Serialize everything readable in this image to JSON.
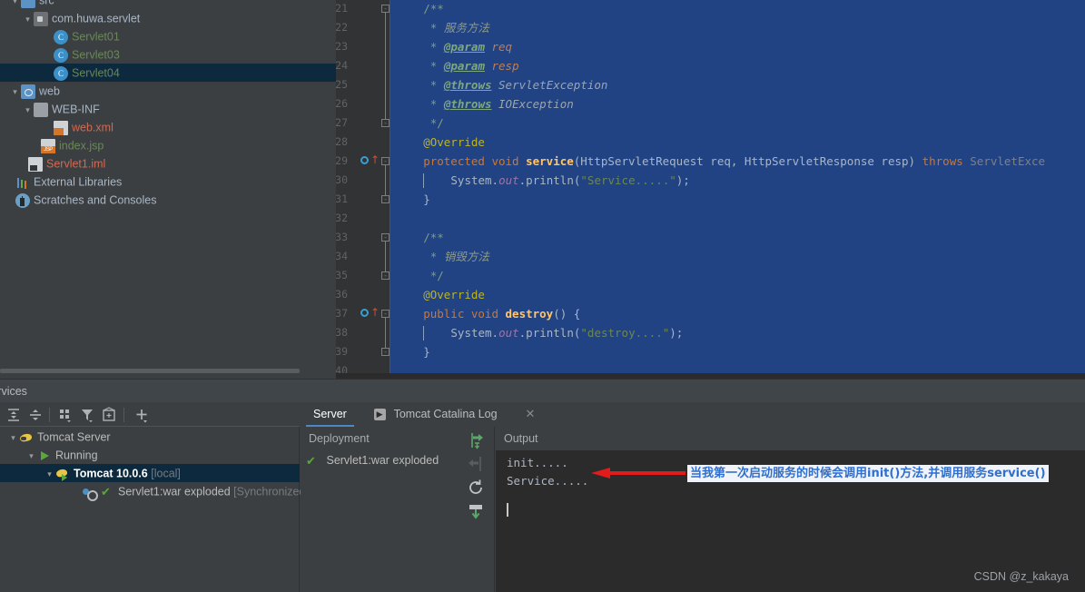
{
  "project_tree": {
    "items": [
      {
        "label": "src",
        "icon": "folder-blue-icon",
        "indent": 10,
        "arrow": "v",
        "color": "grey",
        "selected": false,
        "partial_top": true
      },
      {
        "label": "com.huwa.servlet",
        "icon": "package-icon",
        "indent": 24,
        "arrow": "v",
        "color": "grey",
        "selected": false
      },
      {
        "label": "Servlet01",
        "icon": "java-class-icon",
        "indent": 46,
        "arrow": "",
        "color": "green",
        "selected": false
      },
      {
        "label": "Servlet03",
        "icon": "java-class-icon",
        "indent": 46,
        "arrow": "",
        "color": "green",
        "selected": false
      },
      {
        "label": "Servlet04",
        "icon": "java-class-icon",
        "indent": 46,
        "arrow": "",
        "color": "green",
        "selected": true
      },
      {
        "label": "web",
        "icon": "web-folder-icon",
        "indent": 10,
        "arrow": "v",
        "color": "grey",
        "selected": false
      },
      {
        "label": "WEB-INF",
        "icon": "folder-icon",
        "indent": 24,
        "arrow": "v",
        "color": "grey",
        "selected": false
      },
      {
        "label": "web.xml",
        "icon": "xml-file-icon",
        "indent": 46,
        "arrow": "",
        "color": "red",
        "selected": false
      },
      {
        "label": "index.jsp",
        "icon": "jsp-file-icon",
        "indent": 32,
        "arrow": "",
        "color": "green",
        "selected": false
      },
      {
        "label": "Servlet1.iml",
        "icon": "iml-file-icon",
        "indent": 18,
        "arrow": "",
        "color": "red",
        "selected": false
      },
      {
        "label": "External Libraries",
        "icon": "library-icon",
        "indent": 4,
        "arrow": "",
        "color": "grey",
        "selected": false
      },
      {
        "label": "Scratches and Consoles",
        "icon": "scratches-icon",
        "indent": 4,
        "arrow": "",
        "color": "grey",
        "selected": false
      }
    ]
  },
  "editor": {
    "first_line": 21,
    "last_line": 40,
    "gutter_override_lines": [
      29,
      37
    ],
    "lines": [
      {
        "n": 21,
        "indent": 4,
        "tokens": [
          {
            "t": "/**",
            "c": "c-cmt"
          }
        ]
      },
      {
        "n": 22,
        "indent": 5,
        "tokens": [
          {
            "t": "* ",
            "c": "c-cmt"
          },
          {
            "t": "服务方法",
            "c": "c-cmt-txt"
          }
        ]
      },
      {
        "n": 23,
        "indent": 5,
        "tokens": [
          {
            "t": "* ",
            "c": "c-cmt"
          },
          {
            "t": "@param",
            "c": "c-tag"
          },
          {
            "t": " req",
            "c": "c-param"
          }
        ]
      },
      {
        "n": 24,
        "indent": 5,
        "tokens": [
          {
            "t": "* ",
            "c": "c-cmt"
          },
          {
            "t": "@param",
            "c": "c-tag"
          },
          {
            "t": " resp",
            "c": "c-param"
          }
        ]
      },
      {
        "n": 25,
        "indent": 5,
        "tokens": [
          {
            "t": "* ",
            "c": "c-cmt"
          },
          {
            "t": "@throws",
            "c": "c-tag"
          },
          {
            "t": " ServletException",
            "c": "c-type-it"
          }
        ]
      },
      {
        "n": 26,
        "indent": 5,
        "tokens": [
          {
            "t": "* ",
            "c": "c-cmt"
          },
          {
            "t": "@throws",
            "c": "c-tag"
          },
          {
            "t": " IOException",
            "c": "c-type-it"
          }
        ]
      },
      {
        "n": 27,
        "indent": 5,
        "tokens": [
          {
            "t": "*/",
            "c": "c-cmt"
          }
        ]
      },
      {
        "n": 28,
        "indent": 4,
        "tokens": [
          {
            "t": "@Override",
            "c": "c-ann"
          }
        ]
      },
      {
        "n": 29,
        "indent": 4,
        "tokens": [
          {
            "t": "protected",
            "c": "c-kw"
          },
          {
            "t": " ",
            "c": "c-ident"
          },
          {
            "t": "void",
            "c": "c-kw"
          },
          {
            "t": " ",
            "c": "c-ident"
          },
          {
            "t": "service",
            "c": "c-fn"
          },
          {
            "t": "(HttpServletRequest req, HttpServletResponse resp) ",
            "c": "c-ident"
          },
          {
            "t": "throws",
            "c": "c-kw"
          },
          {
            "t": " ServletExce",
            "c": "c-grey"
          }
        ]
      },
      {
        "n": 30,
        "indent": 8,
        "tokens": [
          {
            "t": "System.",
            "c": "c-ident"
          },
          {
            "t": "out",
            "c": "c-field"
          },
          {
            "t": ".println(",
            "c": "c-ident"
          },
          {
            "t": "\"Service.....\"",
            "c": "c-str"
          },
          {
            "t": ");",
            "c": "c-ident"
          }
        ]
      },
      {
        "n": 31,
        "indent": 4,
        "tokens": [
          {
            "t": "}",
            "c": "c-ident"
          }
        ]
      },
      {
        "n": 32,
        "indent": 0,
        "tokens": []
      },
      {
        "n": 33,
        "indent": 4,
        "tokens": [
          {
            "t": "/**",
            "c": "c-cmt"
          }
        ]
      },
      {
        "n": 34,
        "indent": 5,
        "tokens": [
          {
            "t": "* ",
            "c": "c-cmt"
          },
          {
            "t": "销毁方法",
            "c": "c-cmt-txt"
          }
        ]
      },
      {
        "n": 35,
        "indent": 5,
        "tokens": [
          {
            "t": "*/",
            "c": "c-cmt"
          }
        ]
      },
      {
        "n": 36,
        "indent": 4,
        "tokens": [
          {
            "t": "@Override",
            "c": "c-ann"
          }
        ]
      },
      {
        "n": 37,
        "indent": 4,
        "tokens": [
          {
            "t": "public",
            "c": "c-kw"
          },
          {
            "t": " ",
            "c": "c-ident"
          },
          {
            "t": "void",
            "c": "c-kw"
          },
          {
            "t": " ",
            "c": "c-ident"
          },
          {
            "t": "destroy",
            "c": "c-fn"
          },
          {
            "t": "() {",
            "c": "c-ident"
          }
        ]
      },
      {
        "n": 38,
        "indent": 8,
        "tokens": [
          {
            "t": "System.",
            "c": "c-ident"
          },
          {
            "t": "out",
            "c": "c-field"
          },
          {
            "t": ".println(",
            "c": "c-ident"
          },
          {
            "t": "\"destroy....\"",
            "c": "c-str"
          },
          {
            "t": ");",
            "c": "c-ident"
          }
        ]
      },
      {
        "n": 39,
        "indent": 4,
        "tokens": [
          {
            "t": "}",
            "c": "c-ident"
          }
        ]
      },
      {
        "n": 40,
        "indent": 0,
        "tokens": []
      }
    ]
  },
  "services": {
    "title": "Services",
    "toolbar": [
      {
        "name": "expand-all-icon",
        "tip": "Expand All"
      },
      {
        "name": "collapse-all-icon",
        "tip": "Collapse All"
      },
      {
        "name": "group-by-icon",
        "tip": "Group By"
      },
      {
        "name": "filter-icon",
        "tip": "Filter"
      },
      {
        "name": "show-configurations-icon",
        "tip": "Show Configurations"
      },
      {
        "name": "add-service-icon",
        "tip": "Add Service"
      }
    ],
    "tree": [
      {
        "label": "Tomcat Server",
        "suffix": "",
        "icon": "tomcat-icon",
        "indent": 8,
        "arrow": "v",
        "selected": false,
        "bold": false
      },
      {
        "label": "Running",
        "suffix": "",
        "icon": "run-icon",
        "indent": 28,
        "arrow": "v",
        "selected": false,
        "bold": false
      },
      {
        "label": "Tomcat 10.0.6",
        "suffix": " [local]",
        "icon": "tomcat-running-icon",
        "indent": 48,
        "arrow": "v",
        "selected": true,
        "bold": true
      },
      {
        "label": "Servlet1:war exploded",
        "suffix": " [Synchronized]",
        "icon": "artifact-icon",
        "indent": 78,
        "arrow": "",
        "selected": false,
        "bold": false
      }
    ],
    "tabs": [
      {
        "label": "Server",
        "active": true,
        "closable": false,
        "icon": ""
      },
      {
        "label": "Tomcat Catalina Log",
        "active": false,
        "closable": true,
        "icon": "run-console-icon"
      }
    ],
    "deployment": {
      "header": "Deployment",
      "item": "Servlet1:war exploded",
      "actions": [
        {
          "name": "deploy-icon",
          "enabled": true
        },
        {
          "name": "undeploy-icon",
          "enabled": false
        },
        {
          "name": "redeploy-icon",
          "enabled": true
        },
        {
          "name": "download-icon",
          "enabled": true
        }
      ]
    },
    "output": {
      "header": "Output",
      "lines": [
        "init.....",
        "Service....."
      ]
    }
  },
  "annotation": {
    "text": "当我第一次启动服务的时候会调用init()方法,并调用服务service()",
    "arrow_color": "#e21b1b",
    "text_color": "#2f6fd0"
  },
  "watermark": "CSDN @z_kakaya"
}
